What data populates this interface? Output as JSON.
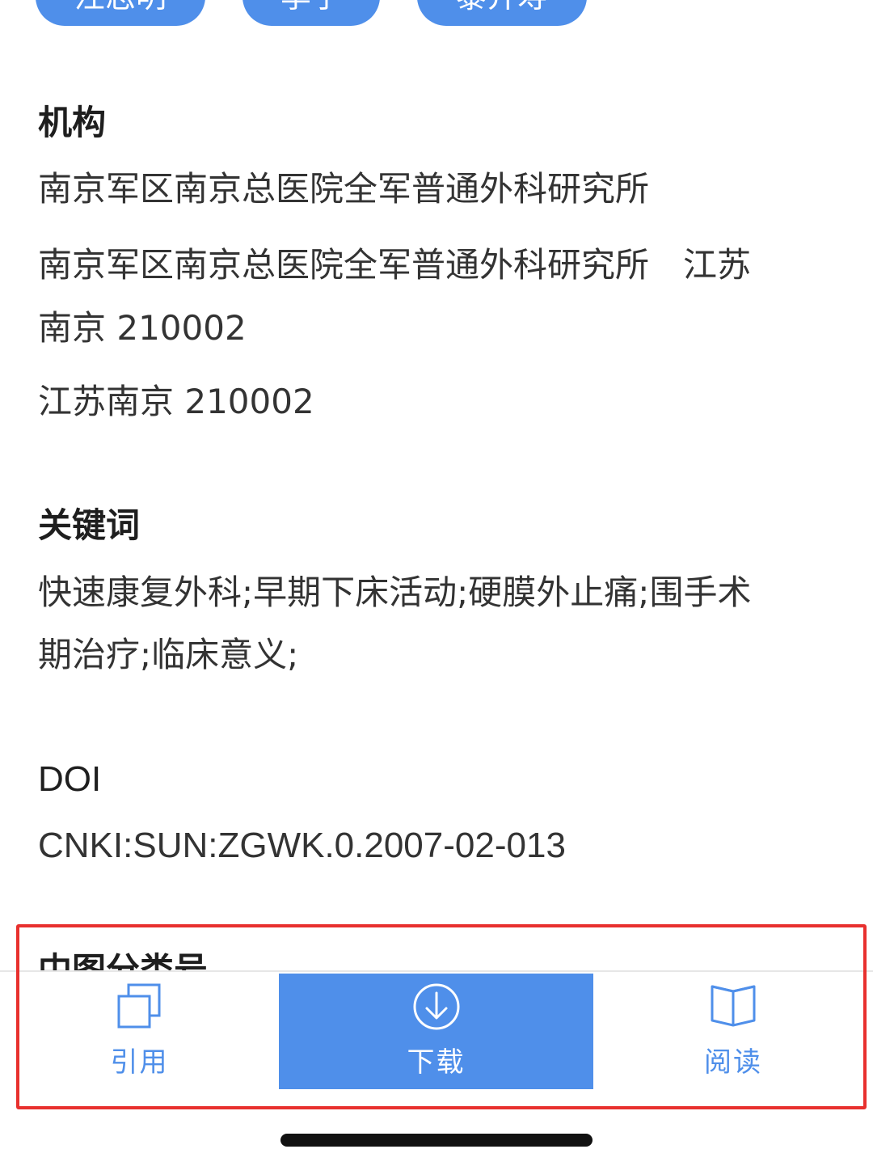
{
  "top_pills": [
    {
      "label": "汪志明"
    },
    {
      "label": "李宁"
    },
    {
      "label": "黎介寿"
    }
  ],
  "sections": {
    "institution": {
      "title": "机构",
      "lines": [
        "南京军区南京总医院全军普通外科研究所",
        "南京军区南京总医院全军普通外科研究所　江苏",
        "南京 210002",
        "江苏南京 210002"
      ]
    },
    "keywords": {
      "title": "关键词",
      "lines": [
        "快速康复外科;早期下床活动;硬膜外止痛;围手术",
        "期治疗;临床意义;"
      ]
    },
    "doi": {
      "title": "DOI",
      "value": "CNKI:SUN:ZGWK.0.2007-02-013"
    },
    "classification": {
      "title": "中图分类号"
    }
  },
  "bottom_bar": {
    "cite": {
      "label": "引用",
      "icon": "copy-icon"
    },
    "download": {
      "label": "下载",
      "icon": "download-circle-icon"
    },
    "read": {
      "label": "阅读",
      "icon": "open-book-icon"
    }
  },
  "colors": {
    "accent": "#4f8fea",
    "highlight": "#e8302e",
    "text": "#333333"
  }
}
